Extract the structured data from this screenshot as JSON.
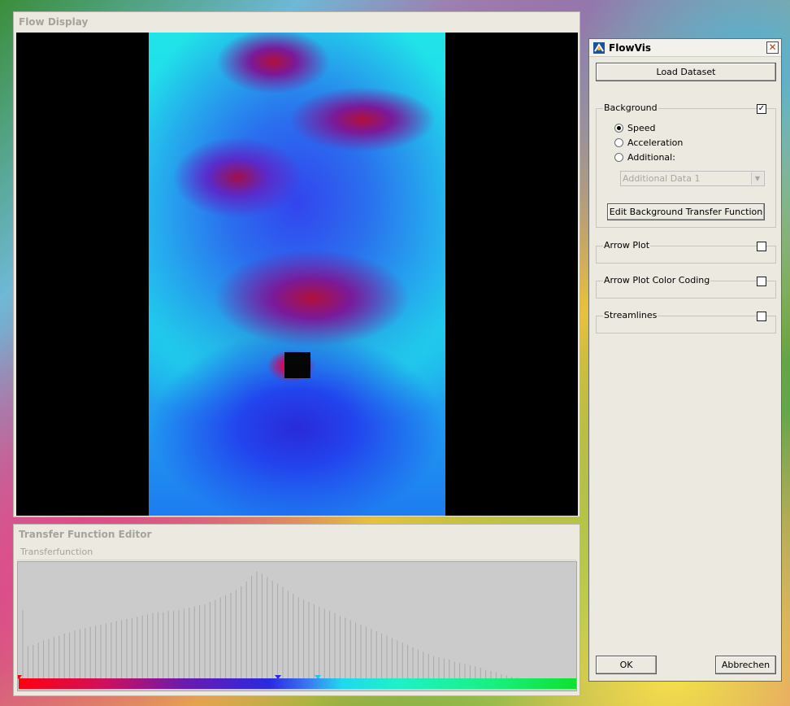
{
  "flow_display": {
    "title": "Flow Display"
  },
  "transfer_function_editor": {
    "title": "Transfer Function Editor",
    "subtitle": "Transferfunction",
    "gradient_colors": [
      "#ff0010",
      "#d0105a",
      "#6a1ab0",
      "#2a2ae0",
      "#3a7af0",
      "#20d8f0",
      "#20f0c8",
      "#18f080",
      "#10e030"
    ],
    "markers": [
      {
        "name": "tf-marker-red",
        "color": "#d01010",
        "position": 0.0
      },
      {
        "name": "tf-marker-blue",
        "color": "#2a2ad8",
        "position": 0.465
      },
      {
        "name": "tf-marker-cyan",
        "color": "#20c8e8",
        "position": 0.537
      }
    ],
    "histogram": [
      0.62,
      0.3,
      0.31,
      0.33,
      0.35,
      0.36,
      0.38,
      0.39,
      0.41,
      0.42,
      0.44,
      0.45,
      0.46,
      0.47,
      0.48,
      0.49,
      0.5,
      0.51,
      0.52,
      0.53,
      0.54,
      0.55,
      0.56,
      0.57,
      0.58,
      0.59,
      0.6,
      0.6,
      0.61,
      0.61,
      0.62,
      0.63,
      0.64,
      0.65,
      0.66,
      0.67,
      0.69,
      0.71,
      0.73,
      0.75,
      0.77,
      0.8,
      0.83,
      0.87,
      0.92,
      0.96,
      0.94,
      0.91,
      0.88,
      0.85,
      0.82,
      0.79,
      0.76,
      0.73,
      0.71,
      0.69,
      0.67,
      0.65,
      0.63,
      0.61,
      0.59,
      0.57,
      0.55,
      0.53,
      0.51,
      0.49,
      0.47,
      0.45,
      0.43,
      0.41,
      0.39,
      0.37,
      0.35,
      0.33,
      0.31,
      0.29,
      0.27,
      0.25,
      0.23,
      0.21,
      0.2,
      0.19,
      0.18,
      0.16,
      0.15,
      0.14,
      0.13,
      0.12,
      0.11,
      0.09,
      0.08,
      0.07,
      0.05,
      0.04,
      0.03,
      0.02
    ]
  },
  "flowvis": {
    "title": "FlowVis",
    "load_dataset": "Load Dataset",
    "background": {
      "label": "Background",
      "checked": true,
      "radios": [
        {
          "label": "Speed",
          "selected": true
        },
        {
          "label": "Acceleration",
          "selected": false
        },
        {
          "label": "Additional:",
          "selected": false
        }
      ],
      "select_value": "Additional Data 1",
      "edit_button": "Edit Background Transfer Function"
    },
    "arrow_plot": {
      "label": "Arrow Plot",
      "checked": false
    },
    "arrow_plot_color_coding": {
      "label": "Arrow Plot Color Coding",
      "checked": false
    },
    "streamlines": {
      "label": "Streamlines",
      "checked": false
    },
    "ok": "OK",
    "cancel": "Abbrechen"
  }
}
